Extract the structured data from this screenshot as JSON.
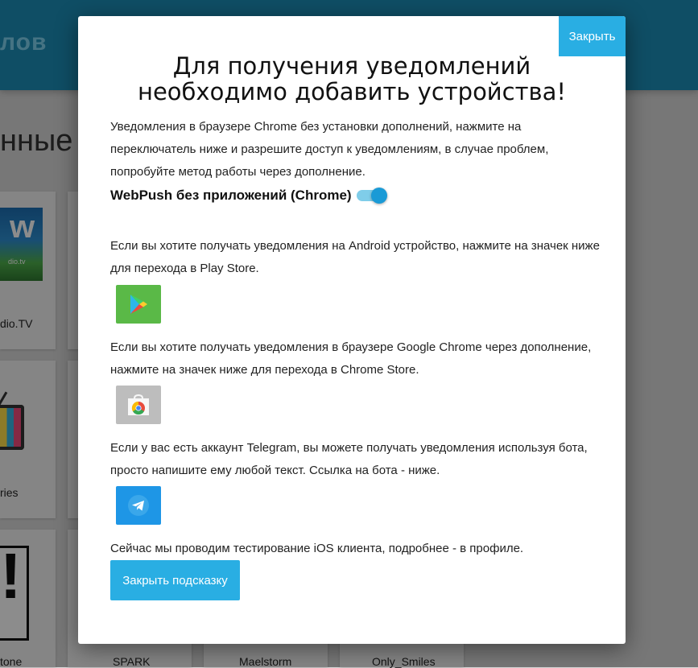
{
  "background": {
    "header_title": "лов",
    "section_title": "нные",
    "cards": [
      {
        "label": "dio.TV",
        "logo": "w",
        "logo_sub": "dio.tv"
      },
      {
        "label": "ries"
      },
      {
        "label": "tone"
      },
      {
        "label": "SPARK"
      },
      {
        "label": "Maelstorm"
      },
      {
        "label": "Only_Smiles"
      }
    ]
  },
  "modal": {
    "close_top_label": "Закрыть",
    "title_line1": "Для получения уведомлений",
    "title_line2": "необходимо добавить устройства!",
    "chrome_text": "Уведомления в браузере Chrome без установки дополнений, нажмите на переключатель ниже и разрешите доступ к уведомлениям, в случае проблем, попробуйте метод работы через дополнение.",
    "webpush_label": "WebPush без приложений (Chrome)",
    "webpush_enabled": true,
    "android_text": "Если вы хотите получать уведомления на Android устройство, нажмите на значек ниже для перехода в Play Store.",
    "chrome_ext_text": "Если вы хотите получать уведомления в браузере Google Chrome через дополнение, нажмите на значек ниже для перехода в Chrome Store.",
    "telegram_text": "Если у вас есть аккаунт Telegram, вы можете получать уведомления используя бота, просто напишите ему любой текст. Ссылка на бота - ниже.",
    "ios_text": "Сейчас мы проводим тестирование iOS клиента, подробнее - в профиле.",
    "close_bottom_label": "Закрыть подсказку"
  },
  "icons": {
    "play_store": "play-store-icon",
    "chrome_store": "chrome-web-store-icon",
    "telegram": "telegram-icon"
  },
  "colors": {
    "accent": "#29aee3",
    "header": "#1d8fb8",
    "play": "#5ab947",
    "telegram": "#1e96e6",
    "chrome_bg": "#bdbdbd"
  }
}
